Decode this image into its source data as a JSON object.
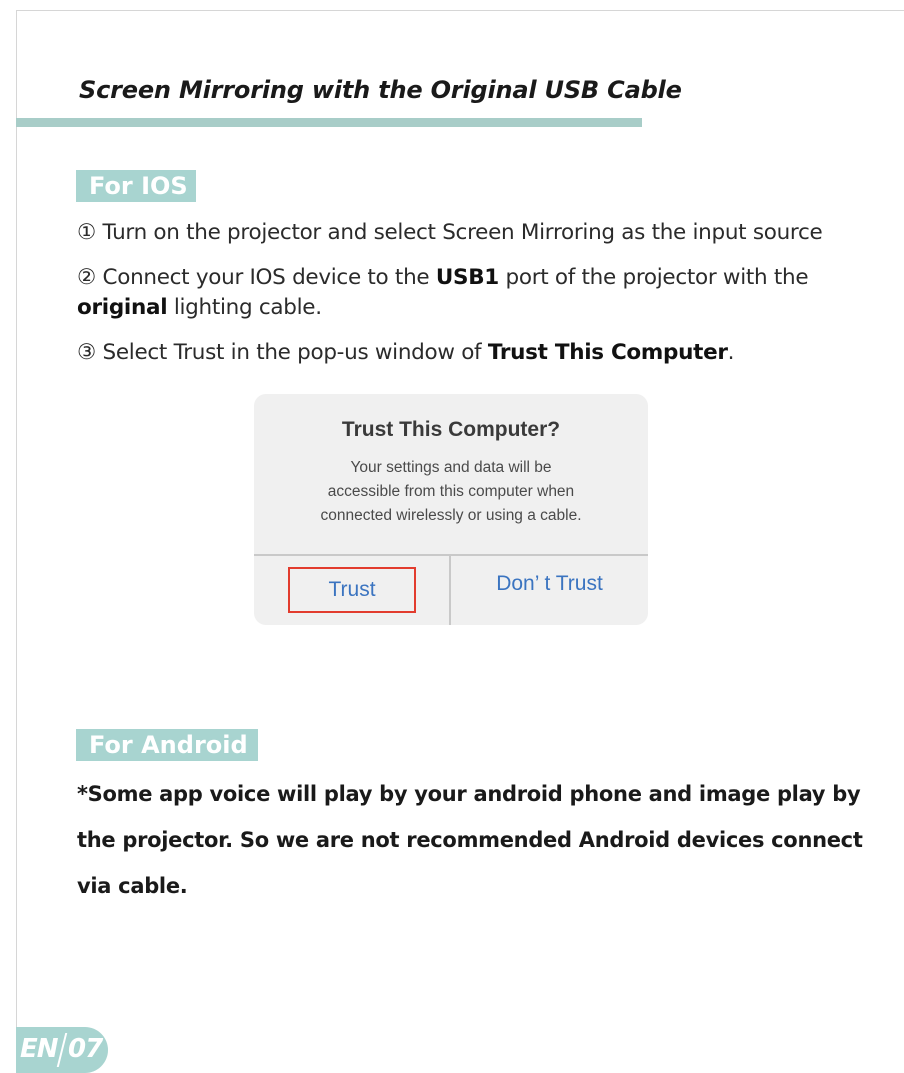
{
  "header": {
    "title": "Screen Mirroring with the Original USB Cable"
  },
  "ios": {
    "tag": "For IOS",
    "step1": "① Turn on the projector and select Screen Mirroring as the input source",
    "step2": {
      "prefix": "② Connect your IOS device to the ",
      "port": "USB1",
      "middle": " port of the projector with the",
      "bold_word": "original",
      "suffix": " lighting cable."
    },
    "step3": {
      "prefix": "③ Select Trust in the pop-us window of ",
      "bold": "Trust This Computer",
      "suffix": "."
    }
  },
  "dialog": {
    "title": "Trust This Computer?",
    "body": [
      "Your settings and data will be",
      "accessible from this computer when",
      "connected wirelessly or using a cable."
    ],
    "trust_label": "Trust",
    "dont_trust_label": "Don’ t Trust"
  },
  "android": {
    "tag": "For Android",
    "note": [
      "*Some app voice will play by your android phone and image play by",
      "the projector. So we are not recommended Android devices connect",
      "via cable."
    ]
  },
  "footer": {
    "lang": "EN",
    "page": "07"
  },
  "colors": {
    "accent": "#a8d4d0",
    "rule": "#a8cdc8",
    "highlight": "#e23c2e",
    "link": "#3b74c0"
  }
}
